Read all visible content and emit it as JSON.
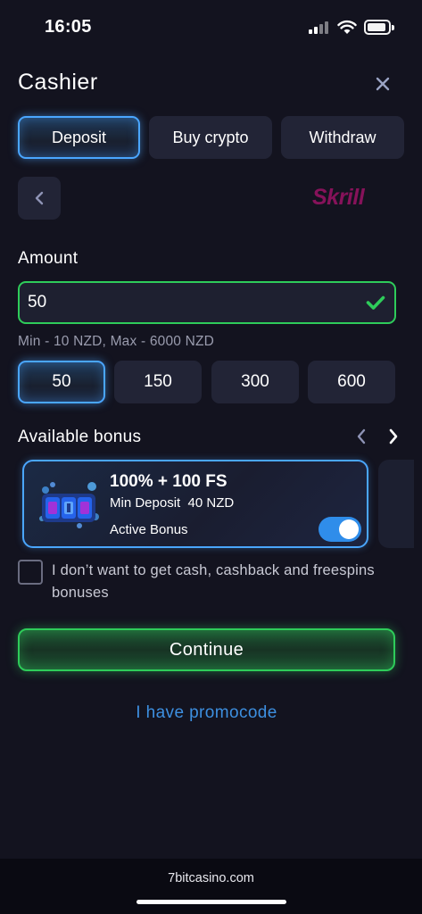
{
  "status_bar": {
    "time": "16:05",
    "icons": [
      "signal-icon",
      "wifi-icon",
      "battery-icon"
    ]
  },
  "header": {
    "title": "Cashier",
    "close_icon": "close-icon"
  },
  "tabs": [
    {
      "label": "Deposit",
      "active": true
    },
    {
      "label": "Buy crypto",
      "active": false
    },
    {
      "label": "Withdraw",
      "active": false
    }
  ],
  "payment": {
    "back_icon": "chevron-left-icon",
    "method_logo": "Skrill"
  },
  "amount": {
    "label": "Amount",
    "value": "50",
    "valid": true,
    "range_hint": "Min - 10 NZD, Max - 6000 NZD",
    "presets": [
      {
        "label": "50",
        "active": true
      },
      {
        "label": "150",
        "active": false
      },
      {
        "label": "300",
        "active": false
      },
      {
        "label": "600",
        "active": false
      }
    ]
  },
  "bonus": {
    "label": "Available bonus",
    "card": {
      "title": "100% + 100 FS",
      "min_deposit": "Min Deposit  40 NZD",
      "active_label": "Active Bonus",
      "active": true
    }
  },
  "opt_out": {
    "checked": false,
    "text": "I don’t want to get cash, cashback and freespins bonuses"
  },
  "continue_label": "Continue",
  "promo_label": "I have promocode",
  "browser": {
    "url": "7bitcasino.com"
  },
  "colors": {
    "background": "#13131f",
    "accent_blue": "#4aa6ff",
    "accent_green": "#2ecc5a",
    "skrill": "#86125a",
    "link": "#3d8fe0"
  }
}
